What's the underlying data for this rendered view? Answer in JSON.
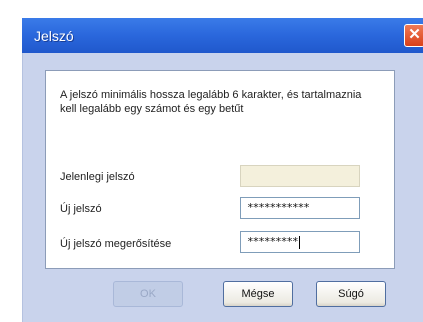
{
  "window": {
    "title": "Jelszó"
  },
  "dialog": {
    "message": "A jelszó minimális hossza legalább 6 karakter, és tartalmaznia kell legalább egy számot és egy betűt",
    "fields": [
      {
        "label": "Jelenlegi jelszó",
        "value": ""
      },
      {
        "label": "Új jelszó",
        "value": "***********"
      },
      {
        "label": "Új jelszó megerősítése",
        "value": "*********"
      }
    ]
  },
  "buttons": {
    "ok": "OK",
    "cancel": "Mégse",
    "help": "Súgó"
  },
  "colors": {
    "titlebar": "#2a67dc",
    "close": "#d9401a"
  }
}
